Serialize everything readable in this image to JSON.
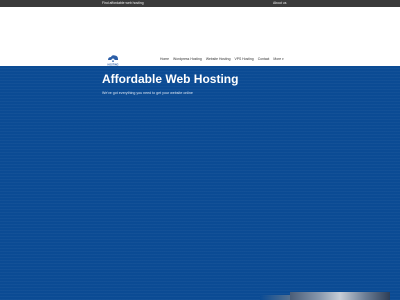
{
  "topbar": {
    "tagline": "Find affordable web hosting",
    "about_label": "About us"
  },
  "logo": {
    "icon": "cloud-house-logo",
    "text": "HOSTING",
    "color": "#2b5ea7"
  },
  "nav": {
    "items": [
      {
        "label": "Home"
      },
      {
        "label": "Wordpress Hosting"
      },
      {
        "label": "Website Hosting"
      },
      {
        "label": "VPS Hosting"
      },
      {
        "label": "Contact"
      },
      {
        "label": "More"
      }
    ]
  },
  "hero": {
    "title": "Affordable Web Hosting",
    "subtitle": "We've got everything you need to get your website online",
    "background_color": "#0b4b94"
  }
}
